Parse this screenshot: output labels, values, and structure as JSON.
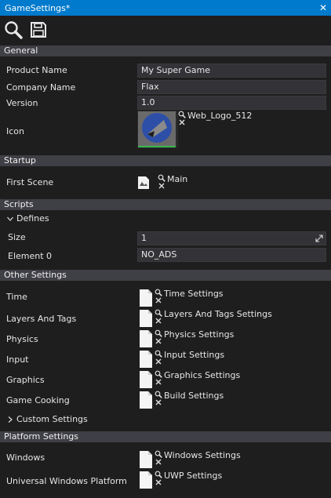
{
  "window": {
    "title": "GameSettings*"
  },
  "toolbar": {
    "search_icon": "search-icon",
    "save_icon": "save-icon"
  },
  "general": {
    "header": "General",
    "product_name_label": "Product Name",
    "product_name_value": "My Super Game",
    "company_name_label": "Company Name",
    "company_name_value": "Flax",
    "version_label": "Version",
    "version_value": "1.0",
    "icon_label": "Icon",
    "icon_asset": "Web_Logo_512"
  },
  "startup": {
    "header": "Startup",
    "first_scene_label": "First Scene",
    "first_scene_asset": "Main"
  },
  "scripts": {
    "header": "Scripts",
    "defines_label": "Defines",
    "size_label": "Size",
    "size_value": "1",
    "element0_label": "Element 0",
    "element0_value": "NO_ADS"
  },
  "other_settings": {
    "header": "Other Settings",
    "items": [
      {
        "label": "Time",
        "asset": "Time Settings"
      },
      {
        "label": "Layers And Tags",
        "asset": "Layers And Tags Settings"
      },
      {
        "label": "Physics",
        "asset": "Physics Settings"
      },
      {
        "label": "Input",
        "asset": "Input Settings"
      },
      {
        "label": "Graphics",
        "asset": "Graphics Settings"
      },
      {
        "label": "Game Cooking",
        "asset": "Build Settings"
      }
    ],
    "custom_settings_label": "Custom Settings"
  },
  "platform_settings": {
    "header": "Platform Settings",
    "items": [
      {
        "label": "Windows",
        "asset": "Windows Settings"
      },
      {
        "label": "Universal Windows Platform",
        "asset": "UWP Settings"
      }
    ]
  },
  "colors": {
    "titlebar": "#007acc",
    "background": "#1e1e1e",
    "group_header": "#3f3f46",
    "textbox": "#333337"
  }
}
